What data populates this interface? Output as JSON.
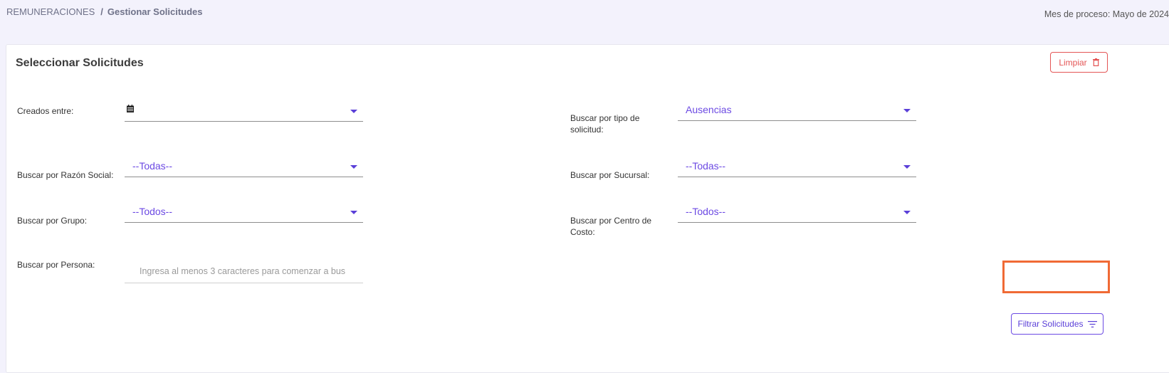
{
  "breadcrumb": {
    "parent": "REMUNERACIONES",
    "separator": "/",
    "current": "Gestionar Solicitudes"
  },
  "process_month": "Mes de proceso: Mayo de 2024",
  "card": {
    "title": "Seleccionar Solicitudes",
    "clear_button": {
      "label": "Limpiar",
      "icon": "trash-icon",
      "color": "#e45555"
    }
  },
  "filters": {
    "created_between": {
      "label": "Creados entre:",
      "value": "",
      "icon": "calendar-icon"
    },
    "request_type": {
      "label": "Buscar por tipo de solicitud:",
      "value": "Ausencias"
    },
    "business_name": {
      "label": "Buscar por Razón Social:",
      "value": "--Todas--"
    },
    "branch": {
      "label": "Buscar por Sucursal:",
      "value": "--Todas--"
    },
    "group": {
      "label": "Buscar por Grupo:",
      "value": "--Todos--"
    },
    "cost_center": {
      "label": "Buscar por Centro de Costo:",
      "value": "--Todos--"
    },
    "person": {
      "label": "Buscar por Persona:",
      "placeholder": "Ingresa al menos 3 caracteres para comenzar a bus"
    }
  },
  "filter_button": {
    "label": "Filtrar Solicitudes",
    "icon": "filter-icon"
  },
  "colors": {
    "accent": "#6c4ae3",
    "danger": "#e45555",
    "highlight": "#f06a35",
    "background": "#f3f2fc"
  }
}
